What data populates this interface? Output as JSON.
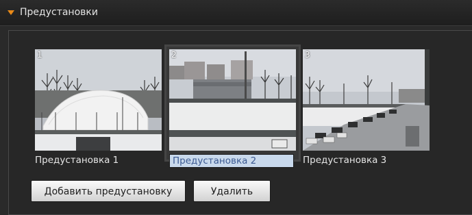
{
  "header": {
    "title": "Предустановки",
    "expand_icon": "triangle-down-icon",
    "accent": "#e98a18"
  },
  "presets": [
    {
      "number": "1",
      "label": "Предустановка 1",
      "selected": false
    },
    {
      "number": "2",
      "label": "Предустановка 2",
      "selected": true
    },
    {
      "number": "3",
      "label": "Предустановка 3",
      "selected": false
    }
  ],
  "buttons": {
    "add_label": "Добавить предустановку",
    "delete_label": "Удалить"
  }
}
